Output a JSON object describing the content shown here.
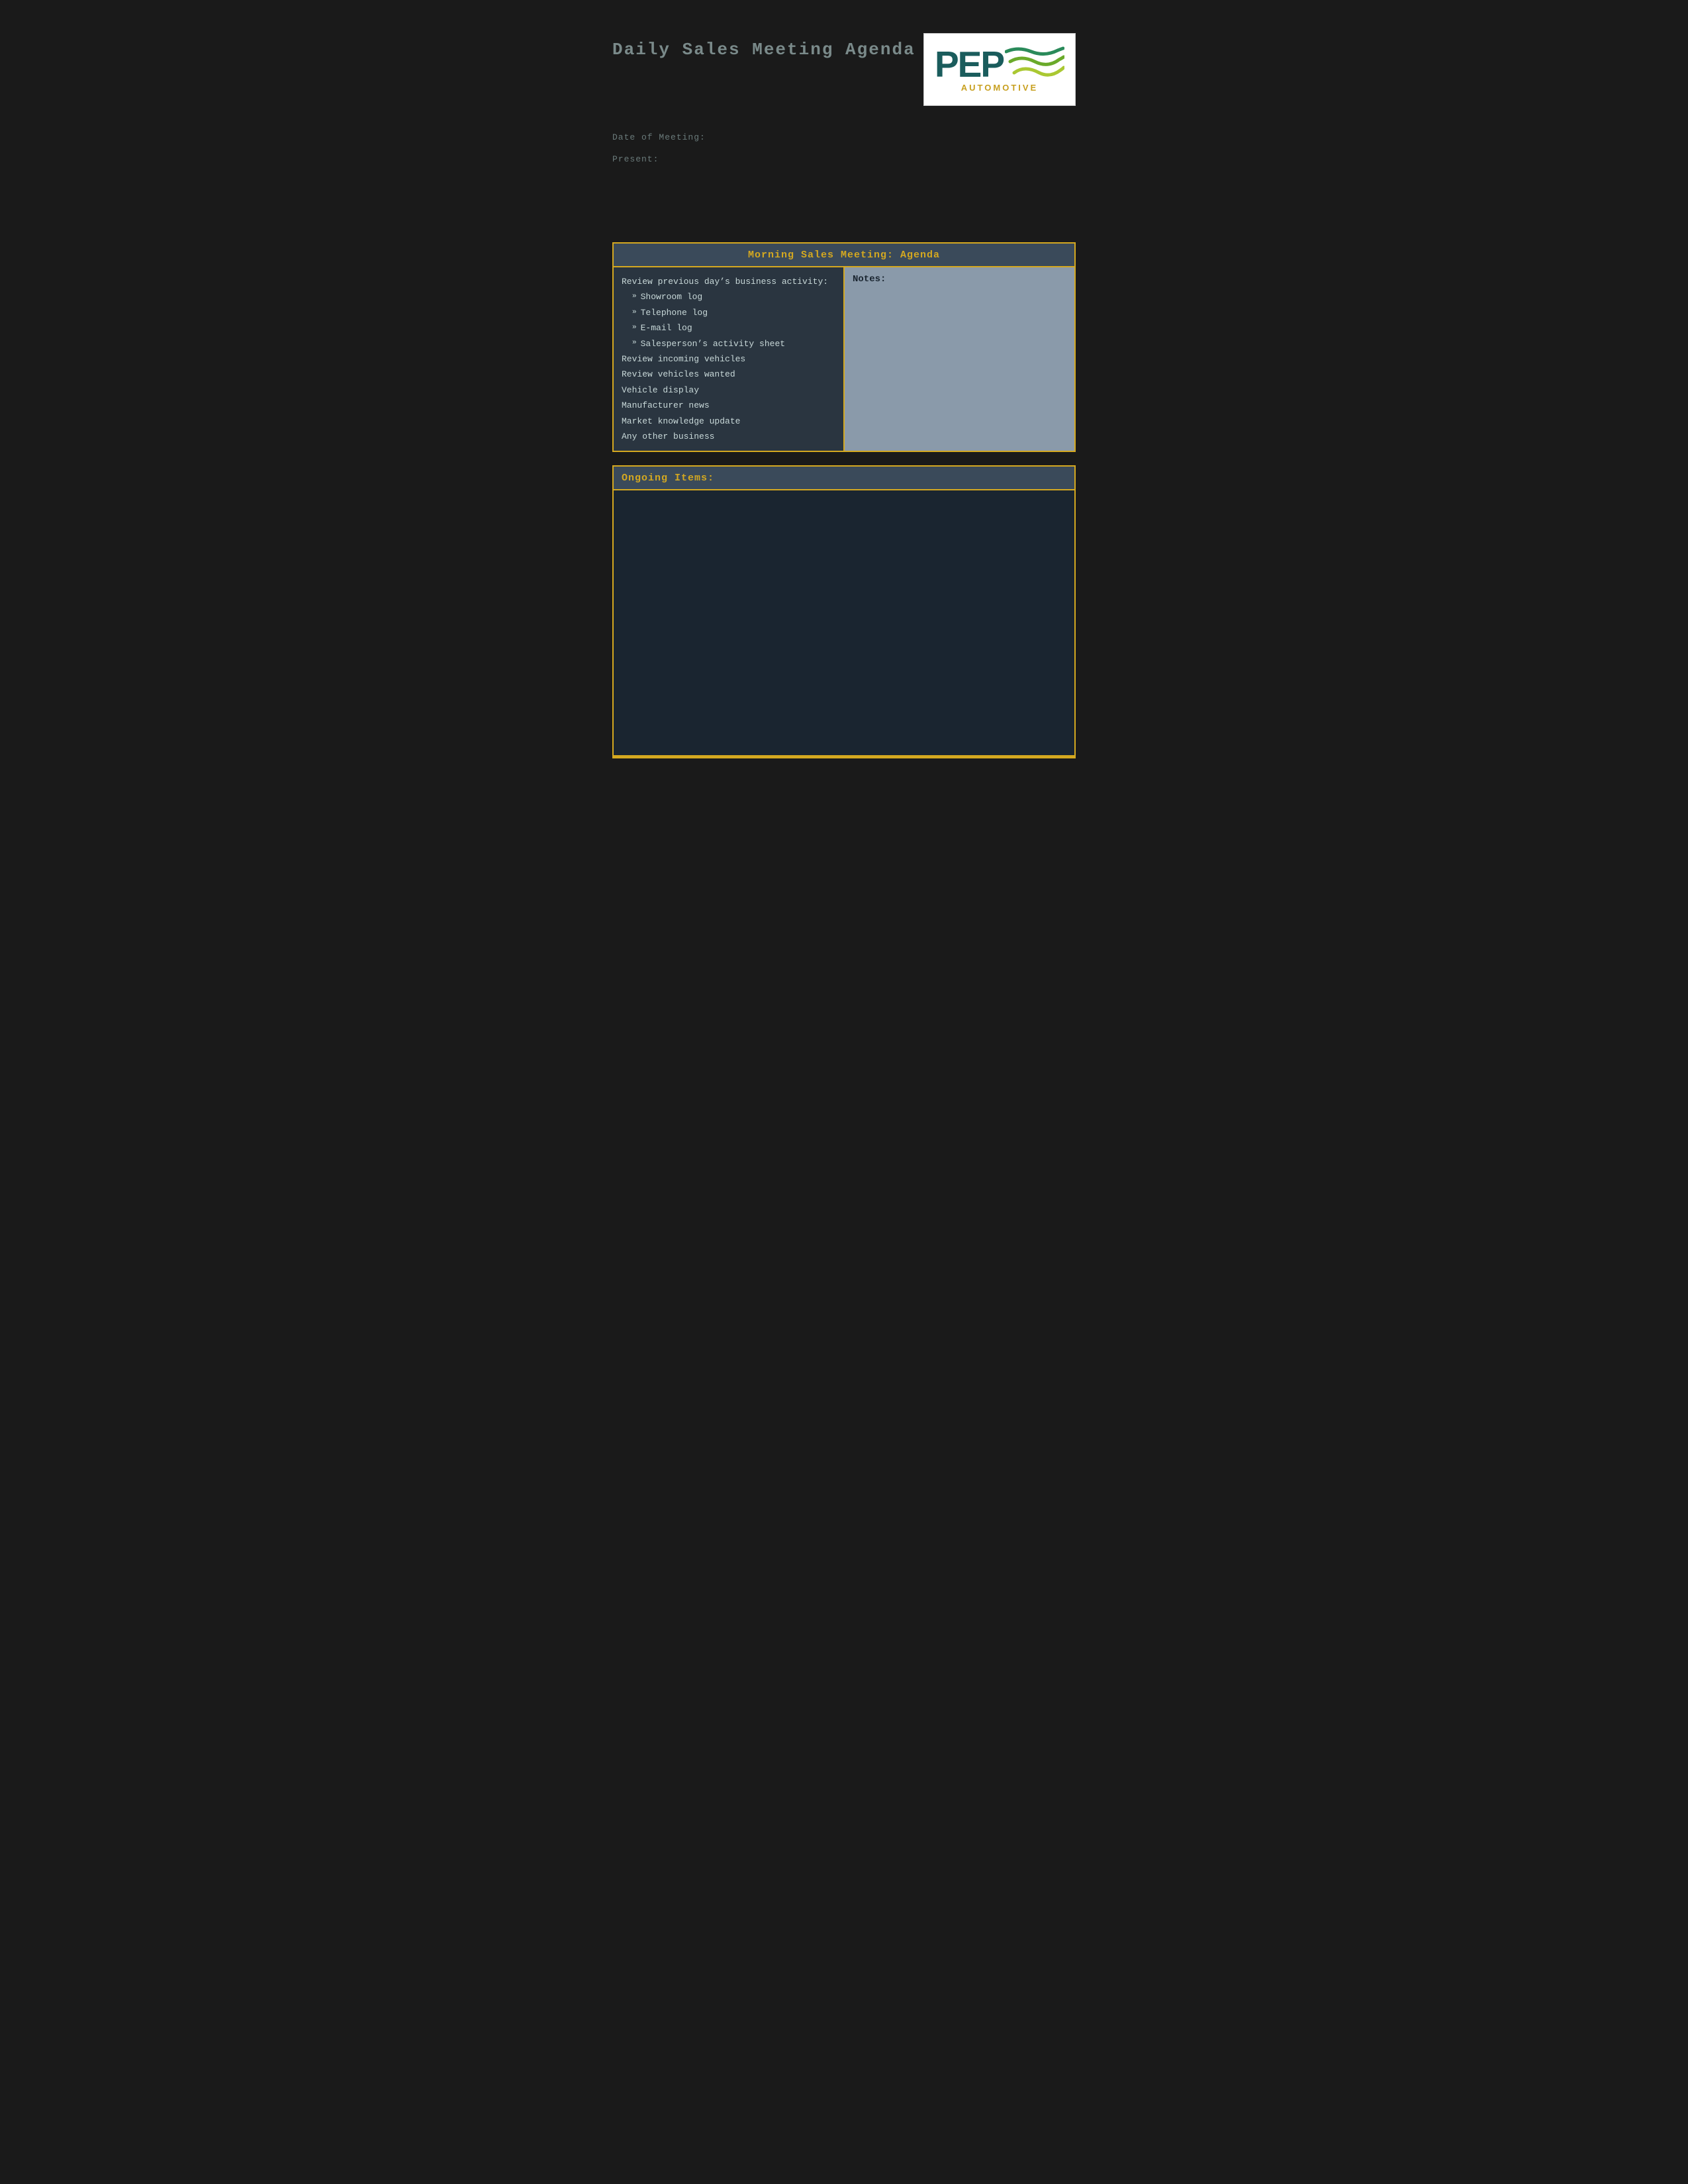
{
  "page": {
    "title": "Daily Sales Meeting Agenda",
    "background_color": "#1a1a1a"
  },
  "logo": {
    "company_name": "PEP",
    "tagline": "AUTOMOTIVE",
    "text_color": "#1a5c5c",
    "tagline_color": "#c8a020"
  },
  "meta": {
    "date_label": "Date of Meeting:",
    "present_label": "Present:"
  },
  "morning_section": {
    "header": "Morning Sales Meeting: Agenda",
    "agenda_items": [
      {
        "type": "main",
        "text": "Review previous day’s business activity:"
      },
      {
        "type": "sub",
        "text": "Showroom log"
      },
      {
        "type": "sub",
        "text": "Telephone log"
      },
      {
        "type": "sub",
        "text": "E-mail log"
      },
      {
        "type": "sub",
        "text": "Salesperson’s activity sheet"
      },
      {
        "type": "main",
        "text": "Review incoming vehicles"
      },
      {
        "type": "main",
        "text": "Review vehicles wanted"
      },
      {
        "type": "main",
        "text": "Vehicle display"
      },
      {
        "type": "main",
        "text": "Manufacturer news"
      },
      {
        "type": "main",
        "text": "Market knowledge update"
      },
      {
        "type": "main",
        "text": "Any other business"
      }
    ],
    "notes_label": "Notes:"
  },
  "ongoing_section": {
    "header": "Ongoing Items:"
  }
}
